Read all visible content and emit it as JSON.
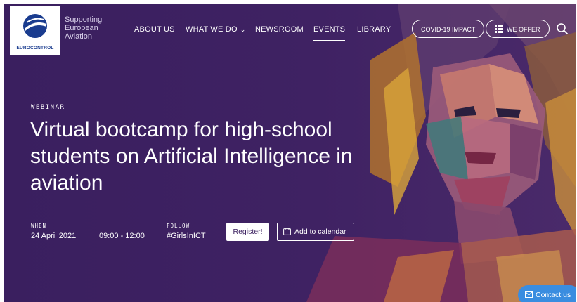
{
  "brand": {
    "logo_text": "EUROCONTROL",
    "tagline": [
      "Supporting",
      "European",
      "Aviation"
    ]
  },
  "nav": {
    "items": [
      {
        "label": "ABOUT US"
      },
      {
        "label": "WHAT WE DO"
      },
      {
        "label": "NEWSROOM"
      },
      {
        "label": "EVENTS",
        "active": true
      },
      {
        "label": "LIBRARY"
      }
    ],
    "covid_label": "COVID-19 IMPACT",
    "offer_label": "WE OFFER"
  },
  "hero": {
    "eyebrow": "WEBINAR",
    "title": "Virtual bootcamp for high-school students on Artificial Intelligence in aviation",
    "when_label": "WHEN",
    "date": "24 April 2021",
    "time": "09:00 - 12:00",
    "follow_label": "FOLLOW",
    "hashtag": "#GirlsInICT",
    "register_label": "Register!",
    "calendar_label": "Add to calendar"
  },
  "contact_label": "Contact us",
  "colors": {
    "background": "#3a1f5f",
    "brand_blue": "#1a3c8f",
    "contact_blue": "#3a8de0"
  },
  "icons": [
    "eurocontrol-logo-icon",
    "chevron-down-icon",
    "grid-icon",
    "search-icon",
    "calendar-icon",
    "mail-icon"
  ]
}
